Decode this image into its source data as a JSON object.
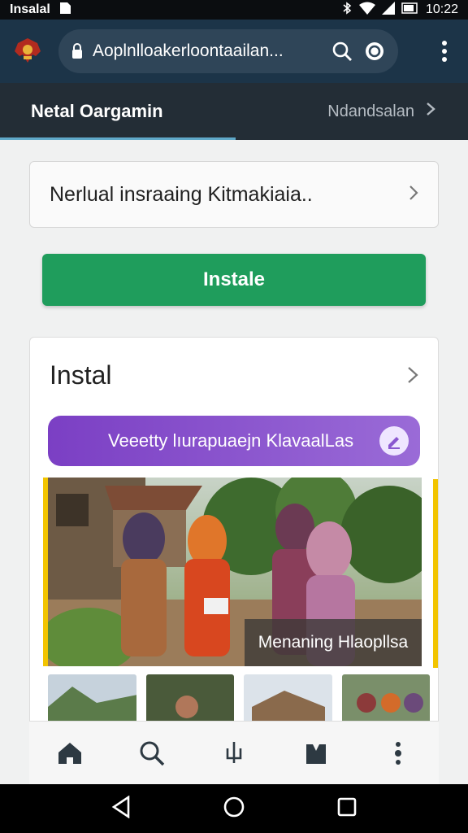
{
  "status_bar": {
    "carrier": "Insalal",
    "time": "10:22"
  },
  "browser": {
    "url": "Aoplnlloakerloontaailan...",
    "icons": [
      "search-icon",
      "tab-count-icon",
      "more-icon"
    ]
  },
  "tabs": {
    "active_label": "Netal Oargamin",
    "other_label": "Ndandsalan"
  },
  "search_card": {
    "text": "Nerlual insraaing Kitmakiaia.."
  },
  "install_button": {
    "label": "Instale"
  },
  "section": {
    "title": "Instal",
    "pill_text": "Veeetty lıurapuaejn KlavaalLas",
    "photo_caption": "Menaning Hlaopllsa"
  },
  "bottom_nav": {
    "items": [
      "home-icon",
      "search-icon",
      "share-icon",
      "bookmark-icon",
      "more-icon"
    ]
  },
  "colors": {
    "header": "#1c3448",
    "tabs": "#232d36",
    "install": "#1f9d5c",
    "pill": "#7b3fc4"
  }
}
